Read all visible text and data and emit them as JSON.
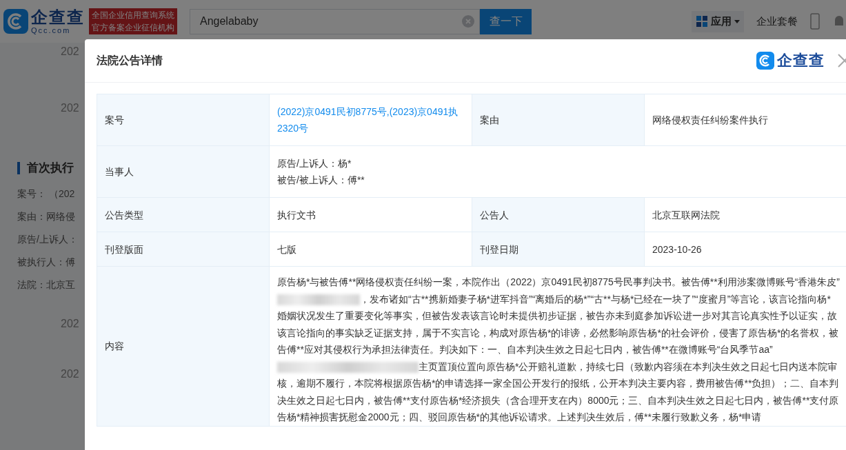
{
  "header": {
    "logo_text": "企查查",
    "logo_domain": "Qcc.com",
    "badge_lines": [
      "全国企业信用查询系统",
      "官方备案企业征信机构"
    ],
    "search": {
      "value": "Angelababy"
    },
    "search_button": "查一下",
    "apps_menu": "应用",
    "package_link": "企业套餐"
  },
  "background": {
    "top_years": [
      "202",
      "202"
    ],
    "section_title": "首次执行",
    "fields": [
      "案号： （202",
      "案由：网络侵",
      "原告/上诉人：",
      "被执行人：傅",
      "法院：北京互"
    ],
    "bottom_years": [
      "202",
      "202"
    ]
  },
  "modal": {
    "title": "法院公告详情",
    "brand": "企查查",
    "rows": [
      {
        "cells": [
          {
            "kind": "label",
            "text": "案号"
          },
          {
            "kind": "link",
            "text": "(2022)京0491民初8775号,(2023)京0491执2320号"
          },
          {
            "kind": "label",
            "text": "案由"
          },
          {
            "kind": "value",
            "text": "网络侵权责任纠纷案件执行"
          }
        ]
      },
      {
        "cells": [
          {
            "kind": "label",
            "text": "当事人"
          },
          {
            "kind": "lines",
            "colspan": 3,
            "lines": [
              "原告/上诉人：杨*",
              "被告/被上诉人：傅**"
            ]
          }
        ]
      },
      {
        "cells": [
          {
            "kind": "label",
            "text": "公告类型"
          },
          {
            "kind": "value",
            "text": "执行文书"
          },
          {
            "kind": "label",
            "text": "公告人"
          },
          {
            "kind": "value",
            "text": "北京互联网法院"
          }
        ]
      },
      {
        "cells": [
          {
            "kind": "label",
            "text": "刊登版面"
          },
          {
            "kind": "value",
            "text": "七版"
          },
          {
            "kind": "label",
            "text": "刊登日期"
          },
          {
            "kind": "value",
            "text": "2023-10-26"
          }
        ]
      },
      {
        "cells": [
          {
            "kind": "label",
            "text": "内容"
          },
          {
            "kind": "paragraph",
            "colspan": 3,
            "parts": [
              {
                "kind": "text",
                "text": "原告杨*与被告傅**网络侵权责任纠纷一案，本院作出（2022）京0491民初8775号民事判决书。被告傅**利用涉案微博账号“香港朱皮”"
              },
              {
                "kind": "redacted"
              },
              {
                "kind": "text",
                "text": "，发布诸如“古**携新婚妻子杨*进军抖音”“离婚后的杨*”“古**与杨*已经在一块了”“度蜜月”等言论，该言论指向杨*婚姻状况发生了重要变化等事实，但被告发表该言论时未提供初步证据，被告亦未到庭参加诉讼进一步对其言论真实性予以证实，故该言论指向的事实缺乏证据支持，属于不实言论，构成对原告杨*的诽谤，必然影响原告杨*的社会评价，侵害了原告杨*的名誉权，被告傅**应对其侵权行为承担法律责任。判决如下：一、自本判决生效之日起七日内，被告傅**在微博账号“台风季节aa”"
              },
              {
                "kind": "redacted"
              },
              {
                "kind": "text",
                "text": "主页置顶位置向原告杨*公开赔礼道歉，持续七日（致歉内容须在本判决生效之日起七日内送本院审核，逾期不履行，本院将根据原告杨*的申请选择一家全国公开发行的报纸，公开本判决主要内容，费用被告傅**负担）；二、自本判决生效之日起七日内，被告傅**支付原告杨*经济损失（含合理开支在内）8000元；三、自本判决生效之日起七日内，被告傅**支付原告杨*精神损害抚慰金2000元；四、驳回原告杨*的其他诉讼请求。上述判决生效后，傅**未履行致歉义务，杨*申请"
              }
            ]
          }
        ]
      }
    ]
  }
}
